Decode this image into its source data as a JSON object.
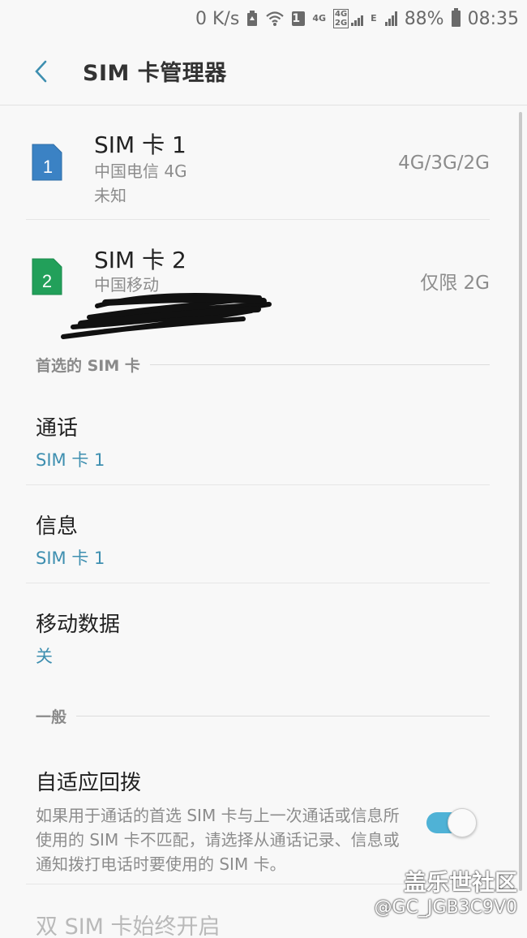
{
  "status_bar": {
    "speed": "0 K/s",
    "sim_badge": "1",
    "net_4g": "4G",
    "net_stack_top": "4G",
    "net_stack_bottom": "2G",
    "net_e": "E",
    "battery": "88%",
    "time": "08:35"
  },
  "app_bar": {
    "title": "SIM 卡管理器"
  },
  "sim_cards": [
    {
      "name": "SIM 卡 1",
      "slot": "1",
      "carrier": "中国电信 4G",
      "status": "未知",
      "network": "4G/3G/2G",
      "color": "#3b82c4"
    },
    {
      "name": "SIM 卡 2",
      "slot": "2",
      "carrier": "中国移动",
      "network": "仅限 2G",
      "color": "#22a05a"
    }
  ],
  "preferred": {
    "header": "首选的 SIM 卡",
    "items": [
      {
        "title": "通话",
        "value": "SIM 卡 1"
      },
      {
        "title": "信息",
        "value": "SIM 卡 1"
      },
      {
        "title": "移动数据",
        "value": "关"
      }
    ]
  },
  "general": {
    "header": "一般",
    "adaptive": {
      "title": "自适应回拨",
      "description": "如果用于通话的首选 SIM 卡与上一次通话或信息所使用的 SIM 卡不匹配，请选择从通话记录、信息或通知拨打电话时要使用的 SIM 卡。",
      "enabled": true
    },
    "dual_sim": {
      "title": "双 SIM 卡始终开启"
    }
  },
  "watermark": {
    "line1": "盖乐世社区",
    "line2": "@GC_JGB3C9V0"
  },
  "colors": {
    "accent": "#3e8fb0",
    "toggle_on": "#4fb2d6"
  }
}
